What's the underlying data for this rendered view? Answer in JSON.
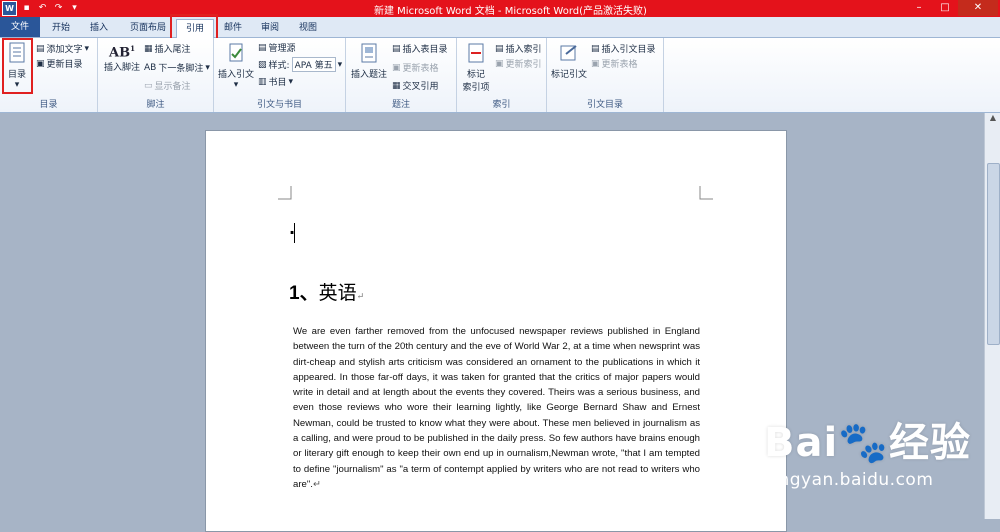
{
  "titlebar": {
    "text": "新建 Microsoft Word 文档 - Microsoft Word(产品激活失败)"
  },
  "tabs": {
    "file": "文件",
    "home": "开始",
    "insert": "插入",
    "layout": "页面布局",
    "references": "引用",
    "mailings": "邮件",
    "review": "审阅",
    "view": "视图"
  },
  "ribbon": {
    "toc": {
      "big": "目录",
      "add_text": "添加文字",
      "update": "更新目录",
      "label": "目录"
    },
    "footnotes": {
      "insert_footnote": "插入脚注",
      "insert_endnote": "插入尾注",
      "next_footnote": "下一条脚注",
      "show_notes": "显示备注",
      "label": "脚注"
    },
    "citations": {
      "insert_citation": "插入引文",
      "manage_sources": "管理源",
      "style_label": "样式:",
      "style_value": "APA 第五",
      "bibliography": "书目",
      "label": "引文与书目"
    },
    "captions": {
      "insert_caption": "插入题注",
      "insert_table_of_figures": "插入表目录",
      "update_table": "更新表格",
      "cross_reference": "交叉引用",
      "label": "题注"
    },
    "index": {
      "mark_entry_line1": "标记",
      "mark_entry_line2": "索引项",
      "insert_index": "插入索引",
      "update_index": "更新索引",
      "label": "索引"
    },
    "toa": {
      "mark_citation": "标记引文",
      "insert_toa": "插入引文目录",
      "update_table": "更新表格",
      "label": "引文目录"
    }
  },
  "document": {
    "cursor_line": "·",
    "heading_num": "1、",
    "heading_text": "英语",
    "paragraph": "We are even farther removed from the unfocused newspaper reviews published in England between the turn of the 20th century and the eve of World War 2, at a time when newsprint was dirt-cheap and stylish arts criticism was considered an ornament to the publications in which it appeared. In those far-off days, it was taken for granted that the critics of major papers would write in detail and at length about the events they covered. Theirs was a serious business, and even those reviews who wore their learning lightly, like George Bernard Shaw and Ernest Newman, could be trusted to know what they were about. These men believed in journalism as a calling, and were proud to be published in the daily press. So few authors have brains enough or literary gift enough to keep their own end up in ournalism,Newman wrote, \"that I am tempted to define \"journalism\" as \"a term of contempt applied by writers who are not read to writers who are\"."
  },
  "watermark": {
    "brand": "Bai",
    "brand2": "经验",
    "url": "jingyan.baidu.com"
  },
  "colors": {
    "titlebar": "#e4121b",
    "file_tab": "#2a5699",
    "highlight": "#e02020"
  }
}
